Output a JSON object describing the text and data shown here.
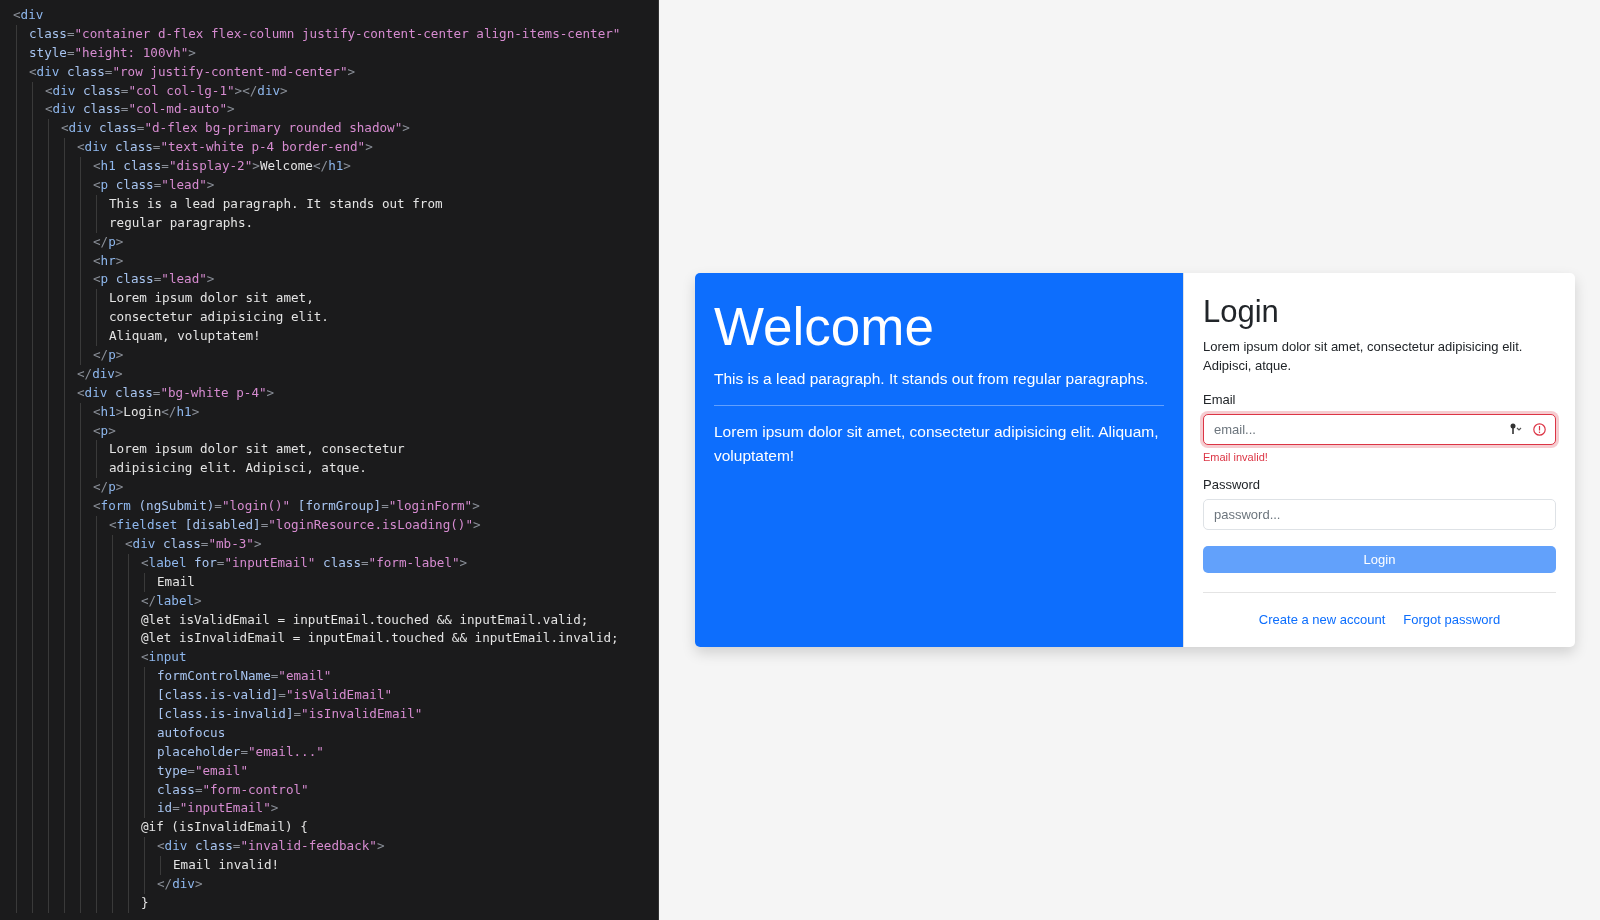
{
  "editor": {
    "lines": [
      {
        "c": [
          {
            "kind": "p",
            "text": "<"
          },
          {
            "kind": "tag",
            "text": "div"
          }
        ],
        "children": [
          {
            "c": [
              {
                "kind": "attr",
                "text": "class"
              },
              {
                "kind": "p",
                "text": "="
              },
              {
                "kind": "str",
                "text": "\"container d-flex flex-column justify-content-center align-items-center\""
              }
            ]
          },
          {
            "c": [
              {
                "kind": "attr",
                "text": "style"
              },
              {
                "kind": "p",
                "text": "="
              },
              {
                "kind": "str",
                "text": "\"height: 100vh\""
              },
              {
                "kind": "p",
                "text": ">"
              }
            ]
          },
          {
            "c": [
              {
                "kind": "p",
                "text": "<"
              },
              {
                "kind": "tag",
                "text": "div"
              },
              {
                "kind": "attr",
                "text": "class"
              },
              {
                "kind": "p",
                "text": "="
              },
              {
                "kind": "str",
                "text": "\"row justify-content-md-center\""
              },
              {
                "kind": "p",
                "text": ">"
              }
            ],
            "children": [
              {
                "c": [
                  {
                    "kind": "p",
                    "text": "<"
                  },
                  {
                    "kind": "tag",
                    "text": "div"
                  },
                  {
                    "kind": "attr",
                    "text": "class"
                  },
                  {
                    "kind": "p",
                    "text": "="
                  },
                  {
                    "kind": "str",
                    "text": "\"col col-lg-1\""
                  },
                  {
                    "kind": "p",
                    "text": "></"
                  },
                  {
                    "kind": "tag",
                    "text": "div"
                  },
                  {
                    "kind": "p",
                    "text": ">"
                  }
                ]
              },
              {
                "c": [
                  {
                    "kind": "p",
                    "text": "<"
                  },
                  {
                    "kind": "tag",
                    "text": "div"
                  },
                  {
                    "kind": "attr",
                    "text": "class"
                  },
                  {
                    "kind": "p",
                    "text": "="
                  },
                  {
                    "kind": "str",
                    "text": "\"col-md-auto\""
                  },
                  {
                    "kind": "p",
                    "text": ">"
                  }
                ],
                "children": [
                  {
                    "c": [
                      {
                        "kind": "p",
                        "text": "<"
                      },
                      {
                        "kind": "tag",
                        "text": "div"
                      },
                      {
                        "kind": "attr",
                        "text": "class"
                      },
                      {
                        "kind": "p",
                        "text": "="
                      },
                      {
                        "kind": "str",
                        "text": "\"d-flex bg-primary rounded shadow\""
                      },
                      {
                        "kind": "p",
                        "text": ">"
                      }
                    ],
                    "children": [
                      {
                        "c": [
                          {
                            "kind": "p",
                            "text": "<"
                          },
                          {
                            "kind": "tag",
                            "text": "div"
                          },
                          {
                            "kind": "attr",
                            "text": "class"
                          },
                          {
                            "kind": "p",
                            "text": "="
                          },
                          {
                            "kind": "str",
                            "text": "\"text-white p-4 border-end\""
                          },
                          {
                            "kind": "p",
                            "text": ">"
                          }
                        ],
                        "children": [
                          {
                            "c": [
                              {
                                "kind": "p",
                                "text": "<"
                              },
                              {
                                "kind": "tag",
                                "text": "h1"
                              },
                              {
                                "kind": "attr",
                                "text": "class"
                              },
                              {
                                "kind": "p",
                                "text": "="
                              },
                              {
                                "kind": "str",
                                "text": "\"display-2\""
                              },
                              {
                                "kind": "p",
                                "text": ">"
                              },
                              {
                                "kind": "text",
                                "text": "Welcome"
                              },
                              {
                                "kind": "p",
                                "text": "</"
                              },
                              {
                                "kind": "tag",
                                "text": "h1"
                              },
                              {
                                "kind": "p",
                                "text": ">"
                              }
                            ]
                          },
                          {
                            "c": [
                              {
                                "kind": "p",
                                "text": "<"
                              },
                              {
                                "kind": "tag",
                                "text": "p"
                              },
                              {
                                "kind": "attr",
                                "text": "class"
                              },
                              {
                                "kind": "p",
                                "text": "="
                              },
                              {
                                "kind": "str",
                                "text": "\"lead\""
                              },
                              {
                                "kind": "p",
                                "text": ">"
                              }
                            ],
                            "children": [
                              {
                                "c": [
                                  {
                                    "kind": "text",
                                    "text": "This is a lead paragraph. It stands out from"
                                  }
                                ]
                              },
                              {
                                "c": [
                                  {
                                    "kind": "text",
                                    "text": "regular paragraphs."
                                  }
                                ]
                              }
                            ]
                          },
                          {
                            "c": [
                              {
                                "kind": "p",
                                "text": "</"
                              },
                              {
                                "kind": "tag",
                                "text": "p"
                              },
                              {
                                "kind": "p",
                                "text": ">"
                              }
                            ]
                          },
                          {
                            "c": [
                              {
                                "kind": "p",
                                "text": "<"
                              },
                              {
                                "kind": "tag",
                                "text": "hr"
                              },
                              {
                                "kind": "p",
                                "text": ">"
                              }
                            ]
                          },
                          {
                            "c": [
                              {
                                "kind": "p",
                                "text": "<"
                              },
                              {
                                "kind": "tag",
                                "text": "p"
                              },
                              {
                                "kind": "attr",
                                "text": "class"
                              },
                              {
                                "kind": "p",
                                "text": "="
                              },
                              {
                                "kind": "str",
                                "text": "\"lead\""
                              },
                              {
                                "kind": "p",
                                "text": ">"
                              }
                            ],
                            "children": [
                              {
                                "c": [
                                  {
                                    "kind": "text",
                                    "text": "Lorem ipsum dolor sit amet,"
                                  }
                                ]
                              },
                              {
                                "c": [
                                  {
                                    "kind": "text",
                                    "text": "consectetur adipisicing elit."
                                  }
                                ]
                              },
                              {
                                "c": [
                                  {
                                    "kind": "text",
                                    "text": "Aliquam, voluptatem!"
                                  }
                                ]
                              }
                            ]
                          },
                          {
                            "c": [
                              {
                                "kind": "p",
                                "text": "</"
                              },
                              {
                                "kind": "tag",
                                "text": "p"
                              },
                              {
                                "kind": "p",
                                "text": ">"
                              }
                            ]
                          }
                        ]
                      },
                      {
                        "c": [
                          {
                            "kind": "p",
                            "text": "</"
                          },
                          {
                            "kind": "tag",
                            "text": "div"
                          },
                          {
                            "kind": "p",
                            "text": ">"
                          }
                        ]
                      },
                      {
                        "c": [
                          {
                            "kind": "p",
                            "text": "<"
                          },
                          {
                            "kind": "tag",
                            "text": "div"
                          },
                          {
                            "kind": "attr",
                            "text": "class"
                          },
                          {
                            "kind": "p",
                            "text": "="
                          },
                          {
                            "kind": "str",
                            "text": "\"bg-white p-4\""
                          },
                          {
                            "kind": "p",
                            "text": ">"
                          }
                        ],
                        "children": [
                          {
                            "c": [
                              {
                                "kind": "p",
                                "text": "<"
                              },
                              {
                                "kind": "tag",
                                "text": "h1"
                              },
                              {
                                "kind": "p",
                                "text": ">"
                              },
                              {
                                "kind": "text",
                                "text": "Login"
                              },
                              {
                                "kind": "p",
                                "text": "</"
                              },
                              {
                                "kind": "tag",
                                "text": "h1"
                              },
                              {
                                "kind": "p",
                                "text": ">"
                              }
                            ]
                          },
                          {
                            "c": [
                              {
                                "kind": "p",
                                "text": "<"
                              },
                              {
                                "kind": "tag",
                                "text": "p"
                              },
                              {
                                "kind": "p",
                                "text": ">"
                              }
                            ],
                            "children": [
                              {
                                "c": [
                                  {
                                    "kind": "text",
                                    "text": "Lorem ipsum dolor sit amet, consectetur"
                                  }
                                ]
                              },
                              {
                                "c": [
                                  {
                                    "kind": "text",
                                    "text": "adipisicing elit. Adipisci, atque."
                                  }
                                ]
                              }
                            ]
                          },
                          {
                            "c": [
                              {
                                "kind": "p",
                                "text": "</"
                              },
                              {
                                "kind": "tag",
                                "text": "p"
                              },
                              {
                                "kind": "p",
                                "text": ">"
                              }
                            ]
                          },
                          {
                            "c": [
                              {
                                "kind": "p",
                                "text": "<"
                              },
                              {
                                "kind": "tag",
                                "text": "form"
                              },
                              {
                                "kind": "attr",
                                "text": "(ngSubmit)"
                              },
                              {
                                "kind": "p",
                                "text": "="
                              },
                              {
                                "kind": "str",
                                "text": "\"login()\""
                              },
                              {
                                "kind": "attr",
                                "text": "[formGroup]"
                              },
                              {
                                "kind": "p",
                                "text": "="
                              },
                              {
                                "kind": "str",
                                "text": "\"loginForm\""
                              },
                              {
                                "kind": "p",
                                "text": ">"
                              }
                            ],
                            "children": [
                              {
                                "c": [
                                  {
                                    "kind": "p",
                                    "text": "<"
                                  },
                                  {
                                    "kind": "tag",
                                    "text": "fieldset"
                                  },
                                  {
                                    "kind": "attr",
                                    "text": "[disabled]"
                                  },
                                  {
                                    "kind": "p",
                                    "text": "="
                                  },
                                  {
                                    "kind": "str",
                                    "text": "\"loginResource.isLoading()\""
                                  },
                                  {
                                    "kind": "p",
                                    "text": ">"
                                  }
                                ],
                                "children": [
                                  {
                                    "c": [
                                      {
                                        "kind": "p",
                                        "text": "<"
                                      },
                                      {
                                        "kind": "tag",
                                        "text": "div"
                                      },
                                      {
                                        "kind": "attr",
                                        "text": "class"
                                      },
                                      {
                                        "kind": "p",
                                        "text": "="
                                      },
                                      {
                                        "kind": "str",
                                        "text": "\"mb-3\""
                                      },
                                      {
                                        "kind": "p",
                                        "text": ">"
                                      }
                                    ],
                                    "children": [
                                      {
                                        "c": [
                                          {
                                            "kind": "p",
                                            "text": "<"
                                          },
                                          {
                                            "kind": "tag",
                                            "text": "label"
                                          },
                                          {
                                            "kind": "attr",
                                            "text": "for"
                                          },
                                          {
                                            "kind": "p",
                                            "text": "="
                                          },
                                          {
                                            "kind": "str",
                                            "text": "\"inputEmail\""
                                          },
                                          {
                                            "kind": "attr",
                                            "text": "class"
                                          },
                                          {
                                            "kind": "p",
                                            "text": "="
                                          },
                                          {
                                            "kind": "str",
                                            "text": "\"form-label\""
                                          },
                                          {
                                            "kind": "p",
                                            "text": ">"
                                          }
                                        ],
                                        "children": [
                                          {
                                            "c": [
                                              {
                                                "kind": "text",
                                                "text": "Email"
                                              }
                                            ]
                                          }
                                        ]
                                      },
                                      {
                                        "c": [
                                          {
                                            "kind": "p",
                                            "text": "</"
                                          },
                                          {
                                            "kind": "tag",
                                            "text": "label"
                                          },
                                          {
                                            "kind": "p",
                                            "text": ">"
                                          }
                                        ]
                                      },
                                      {
                                        "c": [
                                          {
                                            "kind": "text",
                                            "text": "@let isValidEmail = inputEmail.touched && inputEmail.valid;"
                                          }
                                        ]
                                      },
                                      {
                                        "c": [
                                          {
                                            "kind": "text",
                                            "text": "@let isInvalidEmail = inputEmail.touched && inputEmail.invalid;"
                                          }
                                        ]
                                      },
                                      {
                                        "c": [
                                          {
                                            "kind": "p",
                                            "text": "<"
                                          },
                                          {
                                            "kind": "tag",
                                            "text": "input"
                                          }
                                        ],
                                        "children": [
                                          {
                                            "c": [
                                              {
                                                "kind": "attr",
                                                "text": "formControlName"
                                              },
                                              {
                                                "kind": "p",
                                                "text": "="
                                              },
                                              {
                                                "kind": "str",
                                                "text": "\"email\""
                                              }
                                            ]
                                          },
                                          {
                                            "c": [
                                              {
                                                "kind": "attr",
                                                "text": "[class.is-valid]"
                                              },
                                              {
                                                "kind": "p",
                                                "text": "="
                                              },
                                              {
                                                "kind": "str",
                                                "text": "\"isValidEmail\""
                                              }
                                            ]
                                          },
                                          {
                                            "c": [
                                              {
                                                "kind": "attr",
                                                "text": "[class.is-invalid]"
                                              },
                                              {
                                                "kind": "p",
                                                "text": "="
                                              },
                                              {
                                                "kind": "str",
                                                "text": "\"isInvalidEmail\""
                                              }
                                            ]
                                          },
                                          {
                                            "c": [
                                              {
                                                "kind": "attr",
                                                "text": "autofocus"
                                              }
                                            ]
                                          },
                                          {
                                            "c": [
                                              {
                                                "kind": "attr",
                                                "text": "placeholder"
                                              },
                                              {
                                                "kind": "p",
                                                "text": "="
                                              },
                                              {
                                                "kind": "str",
                                                "text": "\"email...\""
                                              }
                                            ]
                                          },
                                          {
                                            "c": [
                                              {
                                                "kind": "attr",
                                                "text": "type"
                                              },
                                              {
                                                "kind": "p",
                                                "text": "="
                                              },
                                              {
                                                "kind": "str",
                                                "text": "\"email\""
                                              }
                                            ]
                                          },
                                          {
                                            "c": [
                                              {
                                                "kind": "attr",
                                                "text": "class"
                                              },
                                              {
                                                "kind": "p",
                                                "text": "="
                                              },
                                              {
                                                "kind": "str",
                                                "text": "\"form-control\""
                                              }
                                            ]
                                          },
                                          {
                                            "c": [
                                              {
                                                "kind": "attr",
                                                "text": "id"
                                              },
                                              {
                                                "kind": "p",
                                                "text": "="
                                              },
                                              {
                                                "kind": "str",
                                                "text": "\"inputEmail\""
                                              },
                                              {
                                                "kind": "p",
                                                "text": ">"
                                              }
                                            ]
                                          }
                                        ]
                                      },
                                      {
                                        "c": [
                                          {
                                            "kind": "text",
                                            "text": "@if (isInvalidEmail) {"
                                          }
                                        ],
                                        "children": [
                                          {
                                            "c": [
                                              {
                                                "kind": "p",
                                                "text": "<"
                                              },
                                              {
                                                "kind": "tag",
                                                "text": "div"
                                              },
                                              {
                                                "kind": "attr",
                                                "text": "class"
                                              },
                                              {
                                                "kind": "p",
                                                "text": "="
                                              },
                                              {
                                                "kind": "str",
                                                "text": "\"invalid-feedback\""
                                              },
                                              {
                                                "kind": "p",
                                                "text": ">"
                                              }
                                            ],
                                            "children": [
                                              {
                                                "c": [
                                                  {
                                                    "kind": "text",
                                                    "text": "Email invalid!"
                                                  }
                                                ]
                                              }
                                            ]
                                          },
                                          {
                                            "c": [
                                              {
                                                "kind": "p",
                                                "text": "</"
                                              },
                                              {
                                                "kind": "tag",
                                                "text": "div"
                                              },
                                              {
                                                "kind": "p",
                                                "text": ">"
                                              }
                                            ]
                                          }
                                        ]
                                      },
                                      {
                                        "c": [
                                          {
                                            "kind": "text",
                                            "text": "}"
                                          }
                                        ]
                                      }
                                    ]
                                  }
                                ]
                              }
                            ]
                          }
                        ]
                      }
                    ]
                  }
                ]
              }
            ]
          }
        ]
      }
    ]
  },
  "welcome": {
    "title": "Welcome",
    "lead": "This is a lead paragraph. It stands out from regular paragraphs.",
    "body": "Lorem ipsum dolor sit amet, consectetur adipisicing elit. Aliquam, voluptatem!"
  },
  "login": {
    "title": "Login",
    "text": "Lorem ipsum dolor sit amet, consectetur adipisicing elit. Adipisci, atque.",
    "email": {
      "label": "Email",
      "placeholder": "email...",
      "invalid": true,
      "error": "Email invalid!"
    },
    "password": {
      "label": "Password",
      "placeholder": "password..."
    },
    "submit": {
      "label": "Login",
      "disabled": true
    },
    "links": [
      "Create a new account",
      "Forgot password"
    ]
  }
}
